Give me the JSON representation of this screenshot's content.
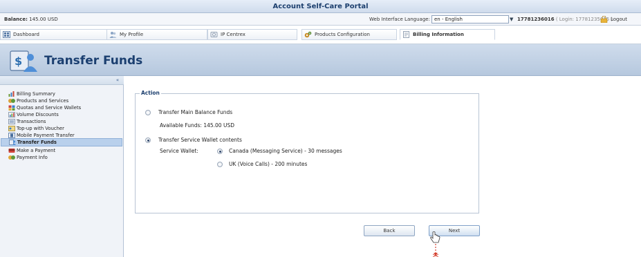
{
  "window": {
    "title": "Account Self-Care Portal"
  },
  "status": {
    "balance_label": "Balance:",
    "balance_value": "145.00 USD",
    "language_label": "Web Interface Language:",
    "language_value": "en - English",
    "account_id": "17781236016",
    "login_text": "( Login: 17781235015 )",
    "logout_label": "Logout"
  },
  "tabs": [
    {
      "label": "Dashboard",
      "icon": "dashboard-icon"
    },
    {
      "label": "My Profile",
      "icon": "profile-icon"
    },
    {
      "label": "IP Centrex",
      "icon": "ip-centrex-icon"
    },
    {
      "label": "Products Configuration",
      "icon": "products-configuration-icon"
    },
    {
      "label": "Billing Information",
      "icon": "billing-icon",
      "active": true
    }
  ],
  "page": {
    "title": "Transfer Funds",
    "icon": "transfer-funds-icon"
  },
  "sidebar": {
    "collapse_label": "«",
    "items": [
      {
        "label": "Billing Summary",
        "icon": "chart-icon"
      },
      {
        "label": "Products and Services",
        "icon": "products-icon"
      },
      {
        "label": "Quotas and Service Wallets",
        "icon": "wallet-icon"
      },
      {
        "label": "Volume Discounts",
        "icon": "discount-icon"
      },
      {
        "label": "Transactions",
        "icon": "transactions-icon"
      },
      {
        "label": "Top-up with Voucher",
        "icon": "voucher-icon"
      },
      {
        "label": "Mobile Payment Transfer",
        "icon": "mobile-payment-icon"
      },
      {
        "label": "Transfer Funds",
        "icon": "transfer-icon",
        "active": true
      },
      {
        "label": "Make a Payment",
        "icon": "payment-icon"
      },
      {
        "label": "Payment Info",
        "icon": "payment-info-icon"
      }
    ]
  },
  "action": {
    "legend": "Action",
    "option_main": "Transfer Main Balance Funds",
    "available_funds": "Available Funds: 145.00 USD",
    "option_wallet": "Transfer Service Wallet contents",
    "service_wallet_label": "Service Wallet:",
    "wallets": [
      {
        "label": "Canada (Messaging Service) - 30 messages",
        "selected": true
      },
      {
        "label": "UK (Voice Calls) - 200 minutes",
        "selected": false
      }
    ],
    "selected_option": "wallet"
  },
  "buttons": {
    "back": "Back",
    "next": "Next"
  },
  "colors": {
    "header": "#1b3f70",
    "accent": "#b9d0ec"
  }
}
